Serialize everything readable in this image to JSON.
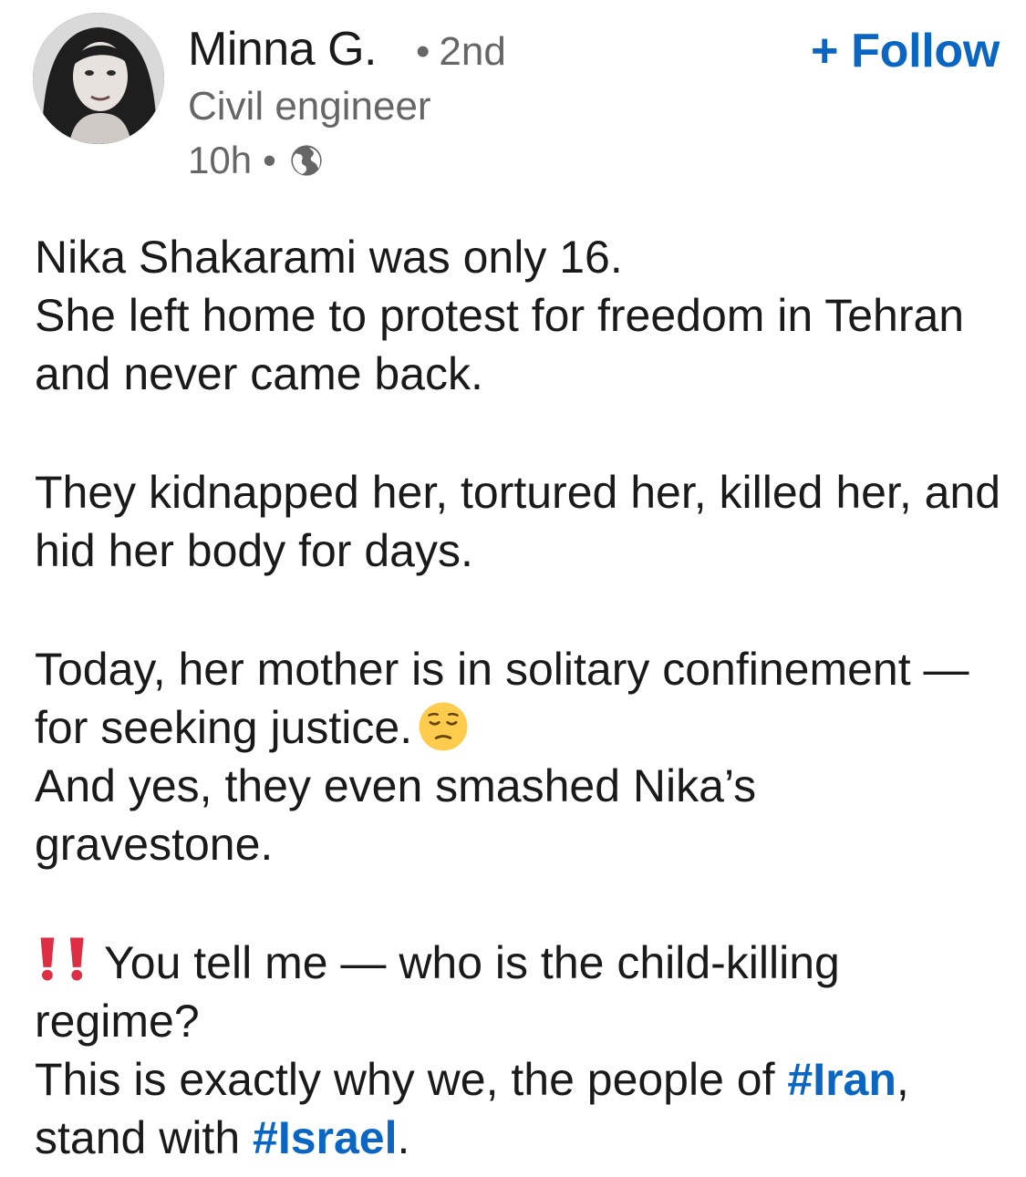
{
  "author": {
    "name": "Minna G.",
    "degree_separator": "•",
    "degree": "2nd",
    "headline": "Civil engineer",
    "avatar_icon": "profile-photo"
  },
  "post_meta": {
    "time": "10h",
    "separator": "•",
    "visibility_icon": "globe-icon"
  },
  "follow_button": {
    "label": "+ Follow",
    "color": "#0a66c2"
  },
  "body": {
    "p1_line1": "Nika Shakarami was only 16.",
    "p1_line2": "She left home to protest for freedom in Tehran and never came back.",
    "p2": "They kidnapped her, tortured her, killed her, and hid her body for days.",
    "p3_line1": "Today, her mother is in solitary confinement — for seeking justice.",
    "p3_emoji": "pensive-face-emoji",
    "p3_line2": "And yes, they even smashed Nika’s gravestone.",
    "p4_icon": "double-exclamation-icon",
    "p4_line1": "You tell me — who is the child-killing regime?",
    "p4_line2_prefix": "This is exactly why we, the people of ",
    "hashtag_iran": "#Iran",
    "p4_line2_mid": ", stand with ",
    "hashtag_israel": "#Israel",
    "p4_line2_end": "."
  }
}
